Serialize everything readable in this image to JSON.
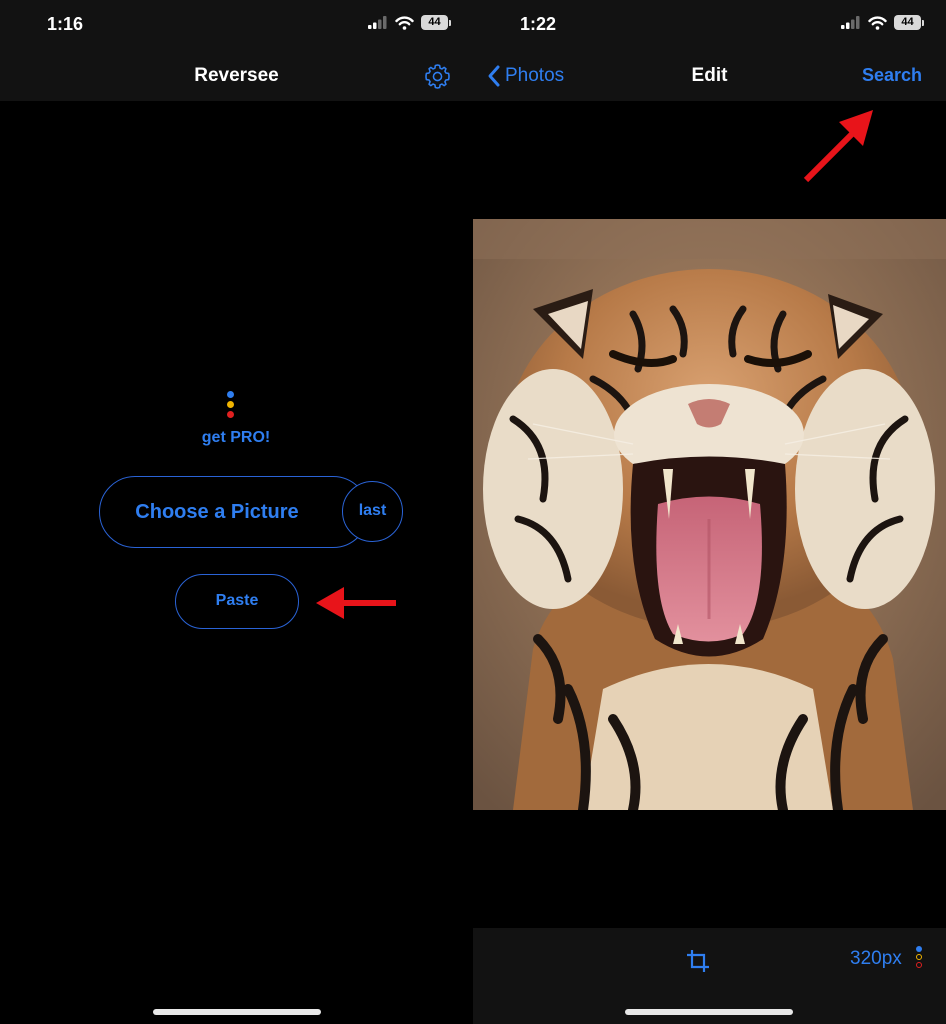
{
  "left_screen": {
    "status": {
      "time": "1:16",
      "battery": "44"
    },
    "nav": {
      "title": "Reversee",
      "settings_icon": "gear-icon"
    },
    "promo": {
      "label": "get PRO!",
      "dot_colors": [
        "#2f7ef0",
        "#f0b400",
        "#e02020"
      ]
    },
    "buttons": {
      "choose": "Choose a Picture",
      "last": "last",
      "paste": "Paste"
    }
  },
  "right_screen": {
    "status": {
      "time": "1:22",
      "battery": "44"
    },
    "nav": {
      "back": "Photos",
      "title": "Edit",
      "action": "Search"
    },
    "toolbar": {
      "crop_icon": "crop-icon",
      "size": "320px",
      "dot_colors": [
        "#2f7ef0",
        "#f0b400",
        "#e02020"
      ]
    }
  },
  "colors": {
    "accent": "#2f7ef0",
    "annotation": "#e8141a",
    "bar_background": "#121212"
  }
}
